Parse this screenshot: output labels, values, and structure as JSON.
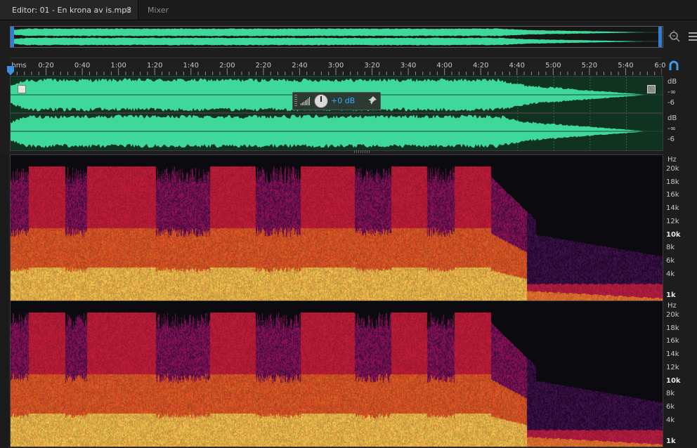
{
  "tabs": {
    "editor_label": "Editor: 01 - En krona av is.mp3",
    "editor_menu_glyph": "≡",
    "mixer_label": "Mixer"
  },
  "toolbar_right": {
    "zoom_icon": "zoom-in-point-icon",
    "list_icon": "menu-list-icon",
    "snap_icon": "snap-magnet-icon"
  },
  "ruler": {
    "unit_label": "hms",
    "duration_seconds": 360,
    "ticks": [
      {
        "label": "0:20",
        "t": 20
      },
      {
        "label": "0:40",
        "t": 40
      },
      {
        "label": "1:00",
        "t": 60
      },
      {
        "label": "1:20",
        "t": 80
      },
      {
        "label": "1:40",
        "t": 100
      },
      {
        "label": "2:00",
        "t": 120
      },
      {
        "label": "2:20",
        "t": 140
      },
      {
        "label": "2:40",
        "t": 160
      },
      {
        "label": "3:00",
        "t": 180
      },
      {
        "label": "3:20",
        "t": 200
      },
      {
        "label": "3:40",
        "t": 220
      },
      {
        "label": "4:00",
        "t": 240
      },
      {
        "label": "4:20",
        "t": 260
      },
      {
        "label": "4:40",
        "t": 280
      },
      {
        "label": "5:00",
        "t": 300
      },
      {
        "label": "5:20",
        "t": 320
      },
      {
        "label": "5:40",
        "t": 340
      },
      {
        "label": "6:0",
        "t": 359
      }
    ]
  },
  "hud": {
    "value": "+0 dB"
  },
  "db_scale": {
    "channel_1": [
      "dB",
      "-∞",
      "-6"
    ],
    "channel_2": [
      "dB",
      "-∞",
      "-6"
    ]
  },
  "hz_scale": {
    "unit": "Hz",
    "labels": [
      {
        "text": "20k",
        "bold": false
      },
      {
        "text": "18k",
        "bold": false
      },
      {
        "text": "16k",
        "bold": false
      },
      {
        "text": "14k",
        "bold": false
      },
      {
        "text": "12k",
        "bold": false
      },
      {
        "text": "10k",
        "bold": true
      },
      {
        "text": "8k",
        "bold": false
      },
      {
        "text": "6k",
        "bold": false
      },
      {
        "text": "4k",
        "bold": false
      },
      {
        "text": "1k",
        "bold": true
      }
    ]
  },
  "colors": {
    "waveform": "#3dd89a",
    "waveform_bg": "#0f3320",
    "accent": "#2f7fd4",
    "hud_value": "#3fa7ff"
  }
}
